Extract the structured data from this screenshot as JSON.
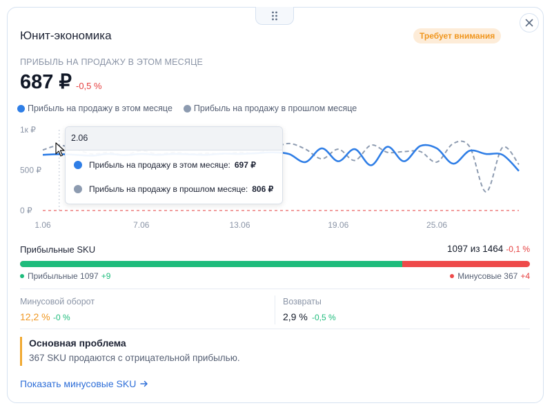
{
  "card": {
    "title": "Юнит-экономика",
    "status_badge": "Требует внимания"
  },
  "metric": {
    "label": "ПРИБЫЛЬ НА ПРОДАЖУ В ЭТОМ МЕСЯЦЕ",
    "value": "687 ₽",
    "delta": "-0,5 %"
  },
  "legend": {
    "current": "Прибыль на продажу в этом месяце",
    "previous": "Прибыль на продажу в прошлом месяце"
  },
  "colors": {
    "current": "#2f7ee6",
    "previous": "#8d9bb0",
    "zero_line": "#e53e3e",
    "positive": "#1ebc7c",
    "negative": "#ee4a4a",
    "warning": "#f0961e"
  },
  "tooltip": {
    "header": "2.06",
    "row_current_label": "Прибыль на продажу в этом месяце:",
    "row_current_value": "697 ₽",
    "row_previous_label": "Прибыль на продажу в прошлом месяце:",
    "row_previous_value": "806 ₽"
  },
  "chart_data": {
    "type": "line",
    "ylim": [
      0,
      1000
    ],
    "y_ticks": [
      "0 ₽",
      "500 ₽",
      "1к ₽"
    ],
    "x_ticks": [
      "1.06",
      "7.06",
      "13.06",
      "19.06",
      "25.06"
    ],
    "x": [
      1,
      2,
      3,
      4,
      5,
      6,
      7,
      8,
      9,
      10,
      11,
      12,
      13,
      14,
      15,
      16,
      17,
      18,
      19,
      20,
      21,
      22,
      23,
      24,
      25,
      26,
      27,
      28,
      29,
      30
    ],
    "series": [
      {
        "name": "Прибыль на продажу в этом месяце",
        "values": [
          690,
          697,
          690,
          680,
          700,
          685,
          700,
          690,
          700,
          695,
          690,
          705,
          700,
          710,
          720,
          700,
          600,
          770,
          610,
          760,
          560,
          790,
          610,
          800,
          770,
          580,
          740,
          700,
          690,
          490
        ]
      },
      {
        "name": "Прибыль на продажу в прошлом месяце",
        "values": [
          750,
          806,
          760,
          700,
          720,
          690,
          740,
          700,
          720,
          700,
          710,
          700,
          720,
          710,
          770,
          830,
          760,
          640,
          760,
          620,
          810,
          720,
          730,
          730,
          600,
          830,
          790,
          230,
          780,
          570
        ]
      }
    ],
    "grid": false,
    "legend": "top-left"
  },
  "sku": {
    "label": "Прибыльные SKU",
    "count": "1097 из 1464",
    "count_delta": "-0,1 %",
    "profitable_share": 0.749,
    "positive_label": "Прибыльные 1097",
    "positive_delta": "+9",
    "negative_label": "Минусовые 367",
    "negative_delta": "+4"
  },
  "stats": {
    "turnover_label": "Минусовой оборот",
    "turnover_value": "12,2 %",
    "turnover_delta": "-0 %",
    "returns_label": "Возвраты",
    "returns_value": "2,9 %",
    "returns_delta": "-0,5 %"
  },
  "problem": {
    "title": "Основная проблема",
    "text": "367 SKU продаются с отрицательной прибылью."
  },
  "link": {
    "label": "Показать минусовые SKU"
  }
}
